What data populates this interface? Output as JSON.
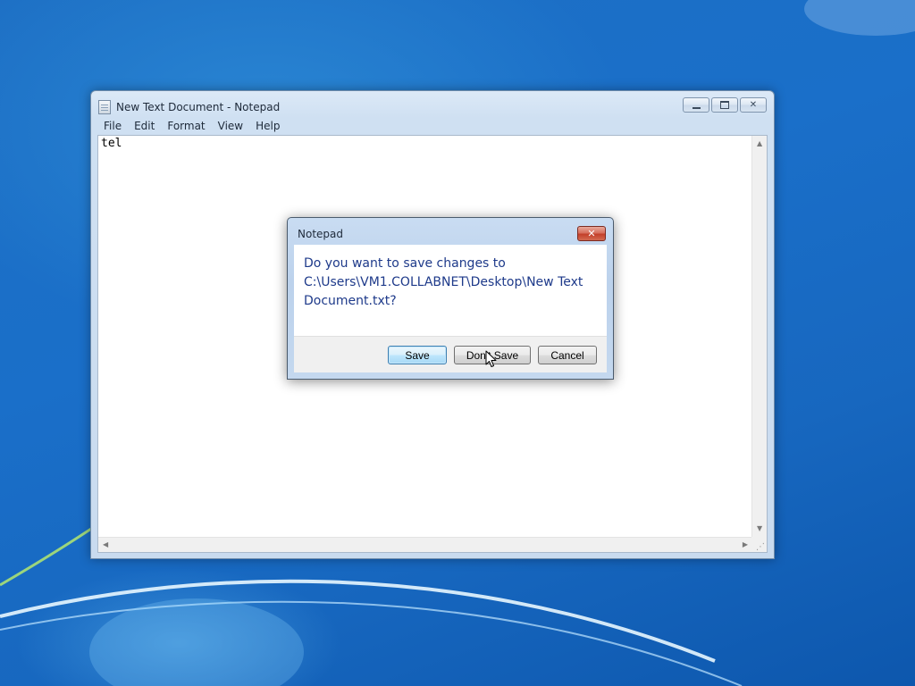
{
  "notepad": {
    "title": "New Text Document - Notepad",
    "menu": [
      "File",
      "Edit",
      "Format",
      "View",
      "Help"
    ],
    "content": "tel",
    "caption_buttons": {
      "minimize": "▭",
      "maximize": "□",
      "close": "✕"
    }
  },
  "dialog": {
    "title": "Notepad",
    "message": "Do you want to save changes to C:\\Users\\VM1.COLLABNET\\Desktop\\New Text Document.txt?",
    "buttons": {
      "save": "Save",
      "dont_save": "Don't Save",
      "cancel": "Cancel"
    },
    "close_glyph": "✕"
  },
  "colors": {
    "desktop_blue": "#1a6fc9",
    "message_text": "#1e3a8a",
    "default_button": "#bee6fd",
    "dialog_close_red": "#c4402a"
  },
  "icons": [
    "notepad-icon",
    "minimize-icon",
    "maximize-icon",
    "close-icon",
    "mouse-cursor"
  ]
}
